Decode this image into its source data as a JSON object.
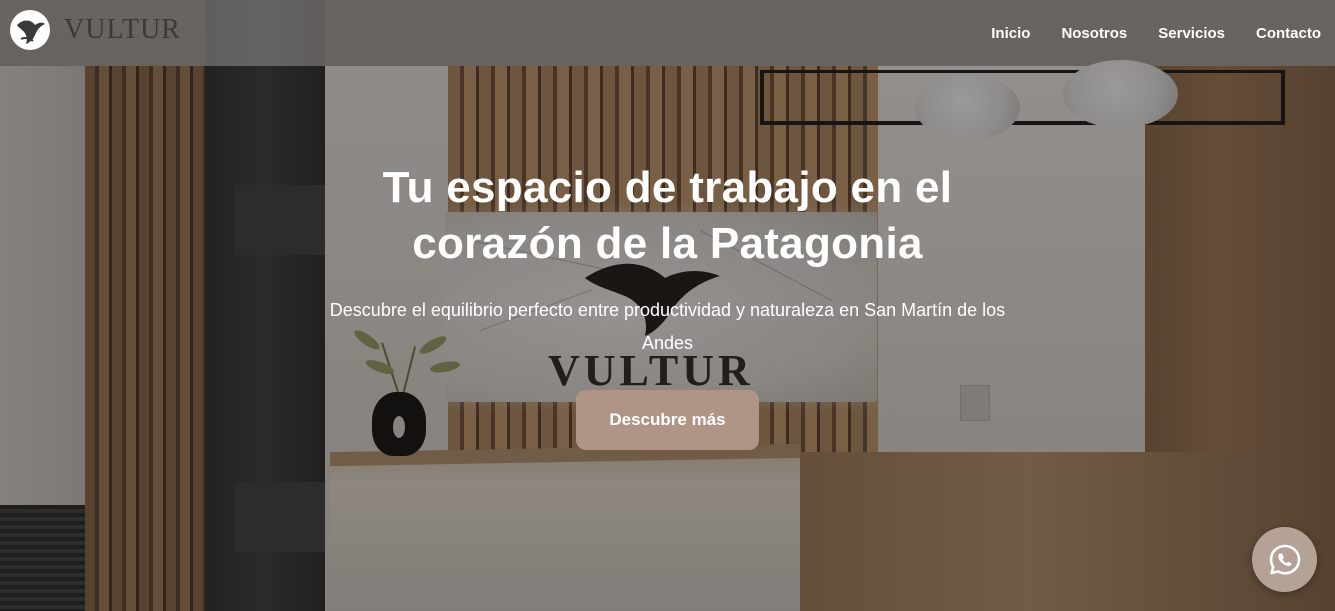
{
  "brand": {
    "name": "VULTUR",
    "logo_icon": "vulture-bird-icon"
  },
  "nav": {
    "items": [
      {
        "label": "Inicio"
      },
      {
        "label": "Nosotros"
      },
      {
        "label": "Servicios"
      },
      {
        "label": "Contacto"
      }
    ]
  },
  "hero": {
    "title": "Tu espacio de trabajo en el corazón de la Patagonia",
    "subtitle": "Descubre el equilibrio perfecto entre productividad y naturaleza en San Martín de los Andes",
    "cta_label": "Descubre más",
    "background_sign_text": "VULTUR"
  },
  "floating": {
    "whatsapp_icon": "whatsapp-icon"
  },
  "colors": {
    "cta_background": "#b09586",
    "whatsapp_background": "#b5a297",
    "nav_text": "#ffffff"
  }
}
